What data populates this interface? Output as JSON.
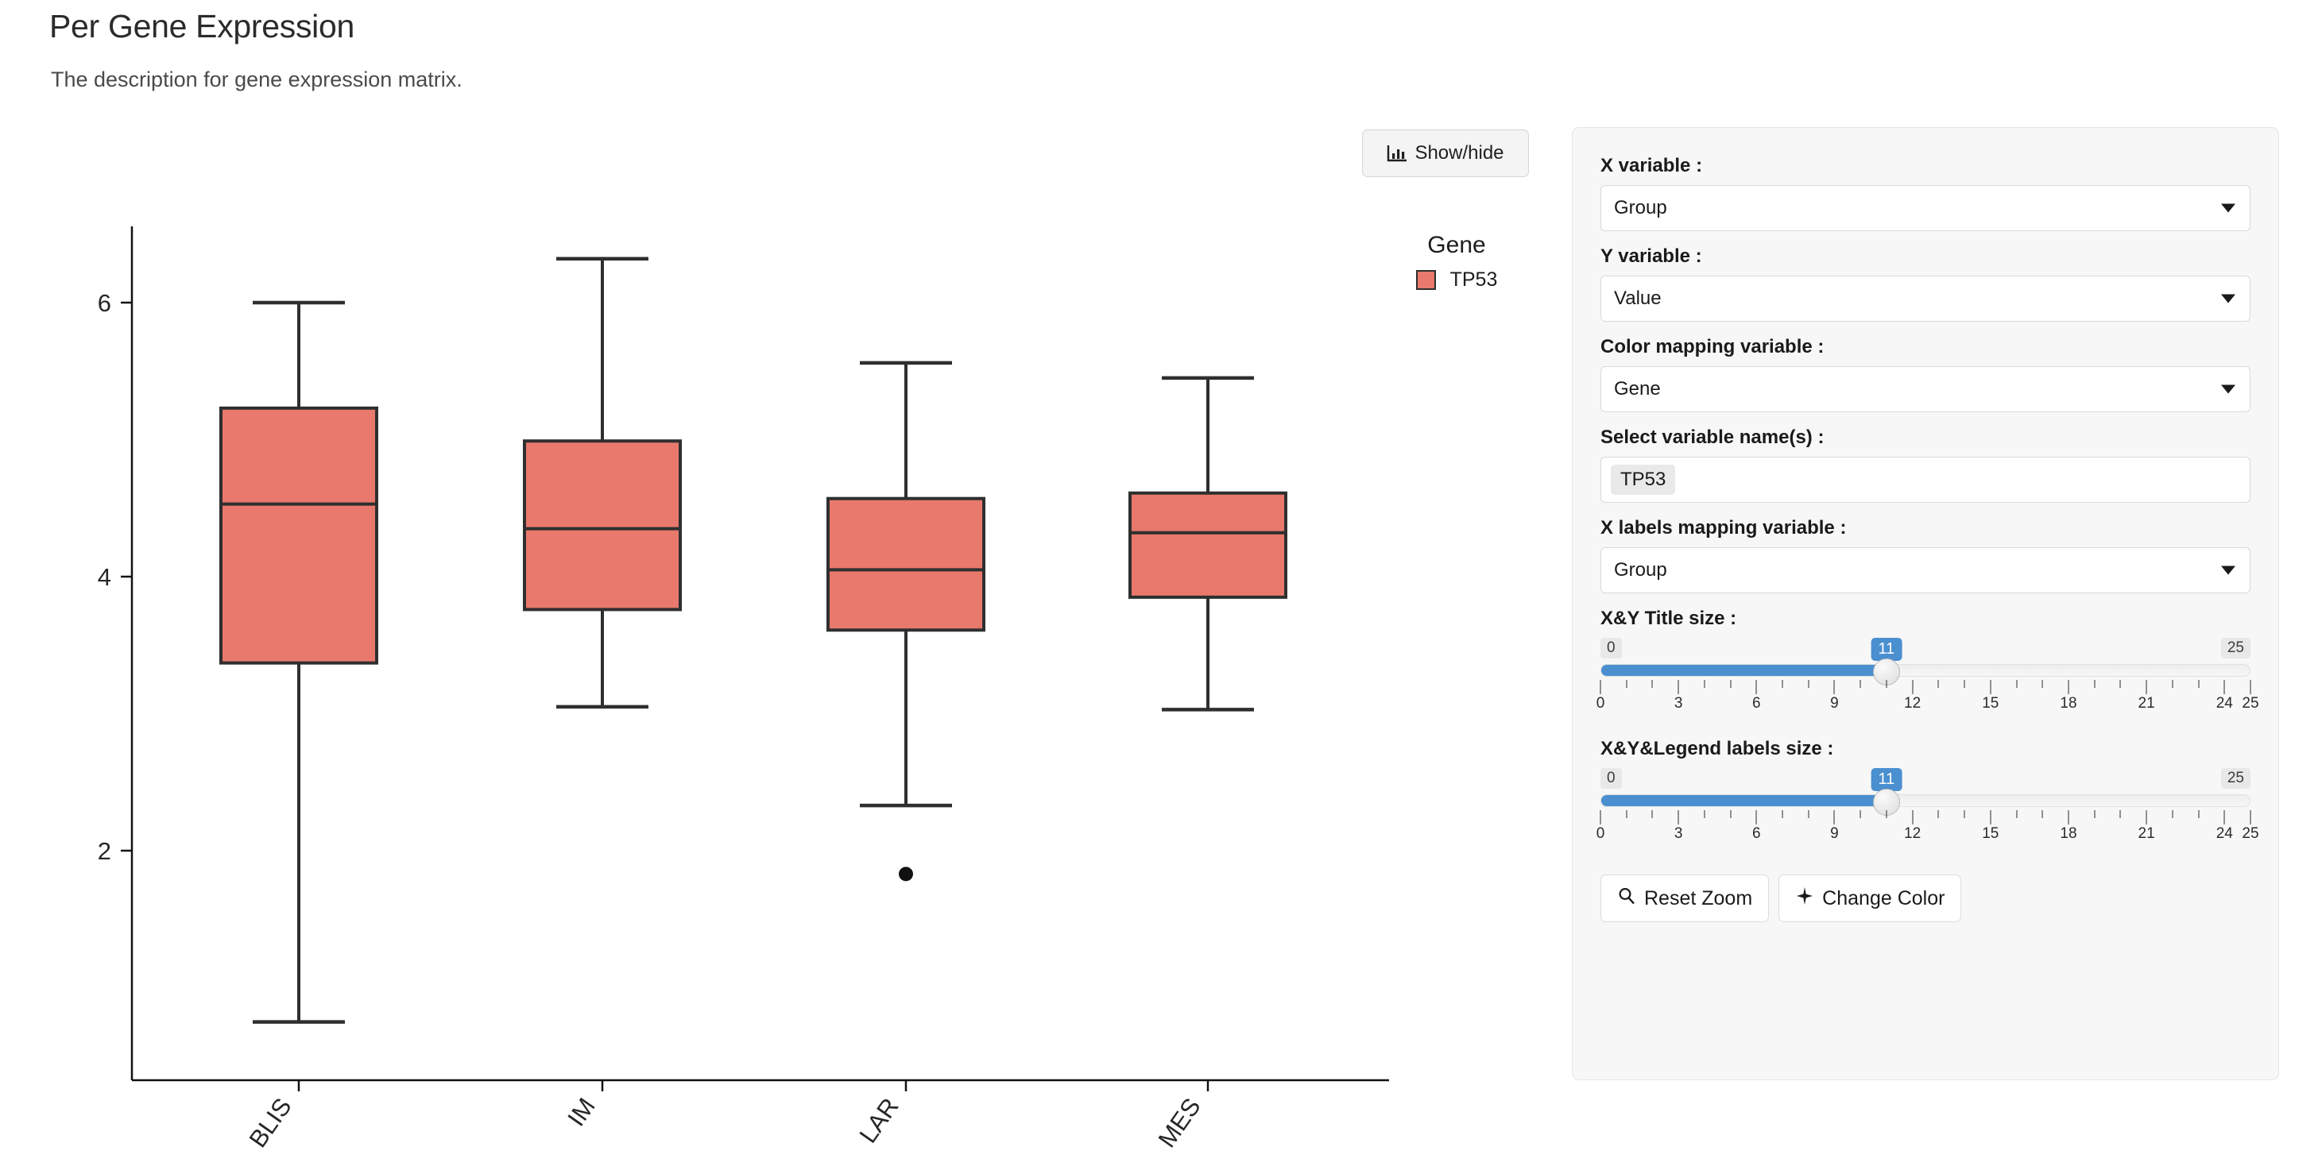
{
  "header": {
    "title": "Per Gene Expression",
    "description": "The description for gene expression matrix."
  },
  "toolbar": {
    "showhide_label": "Show/hide",
    "showhide_icon": "bar-chart-icon"
  },
  "legend": {
    "title": "Gene",
    "entries": [
      {
        "label": "TP53",
        "color": "#e8796c"
      }
    ]
  },
  "panel": {
    "fields": [
      {
        "label": "X variable :",
        "value": "Group",
        "type": "select"
      },
      {
        "label": "Y variable :",
        "value": "Value",
        "type": "select"
      },
      {
        "label": "Color mapping variable :",
        "value": "Gene",
        "type": "select"
      },
      {
        "label": "Select variable name(s) :",
        "value": "TP53",
        "type": "tags"
      },
      {
        "label": "X labels mapping variable :",
        "value": "Group",
        "type": "select"
      }
    ],
    "sliders": [
      {
        "label": "X&Y Title size :",
        "value": 11,
        "min": 0,
        "max": 25,
        "min_label": "0",
        "max_label": "25",
        "value_label": "11",
        "ticks": [
          0,
          3,
          6,
          9,
          12,
          15,
          18,
          21,
          24,
          25
        ],
        "accent": "#4a8fd0"
      },
      {
        "label": "X&Y&Legend labels size :",
        "value": 11,
        "min": 0,
        "max": 25,
        "min_label": "0",
        "max_label": "25",
        "value_label": "11",
        "ticks": [
          0,
          3,
          6,
          9,
          12,
          15,
          18,
          21,
          24,
          25
        ],
        "accent": "#4a8fd0"
      }
    ],
    "buttons": [
      {
        "label": "Reset Zoom",
        "icon": "magnifier-icon"
      },
      {
        "label": "Change Color",
        "icon": "sparkle-icon"
      }
    ]
  },
  "chart_data": {
    "type": "boxplot",
    "title": "",
    "xlabel": "",
    "ylabel": "",
    "categories": [
      "BLIS",
      "IM",
      "LAR",
      "MES"
    ],
    "yticks": [
      2,
      4,
      6
    ],
    "ylim": [
      0.45,
      6.55
    ],
    "grid": false,
    "legend_position": "right",
    "box_color": "#e8796c",
    "line_color": "#2f2f2f",
    "series_name": "TP53",
    "boxes": [
      {
        "category": "BLIS",
        "whisker_low": 0.75,
        "q1": 3.37,
        "median": 4.53,
        "q3": 5.23,
        "whisker_high": 6.0,
        "outliers": []
      },
      {
        "category": "IM",
        "whisker_low": 3.05,
        "q1": 3.76,
        "median": 4.35,
        "q3": 4.99,
        "whisker_high": 6.32,
        "outliers": []
      },
      {
        "category": "LAR",
        "whisker_low": 2.33,
        "q1": 3.61,
        "median": 4.05,
        "q3": 4.57,
        "whisker_high": 5.56,
        "outliers": [
          1.83
        ]
      },
      {
        "category": "MES",
        "whisker_low": 3.03,
        "q1": 3.85,
        "median": 4.32,
        "q3": 4.61,
        "whisker_high": 5.45,
        "outliers": []
      }
    ]
  }
}
